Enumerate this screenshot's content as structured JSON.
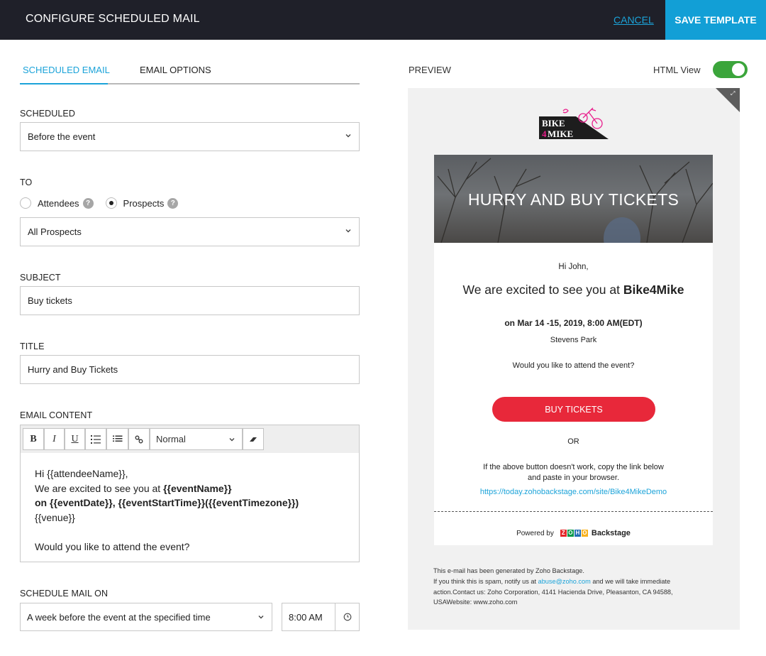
{
  "header": {
    "title": "CONFIGURE SCHEDULED MAIL",
    "cancel_label": "CANCEL",
    "save_label": "SAVE TEMPLATE"
  },
  "colors": {
    "header_bg": "#1f2029",
    "accent": "#129fd6",
    "toggle_on": "#3ba53b",
    "cta_red": "#e8283a"
  },
  "tabs": [
    {
      "label": "SCHEDULED EMAIL",
      "active": true
    },
    {
      "label": "EMAIL OPTIONS",
      "active": false
    }
  ],
  "form": {
    "scheduled": {
      "label": "SCHEDULED",
      "value": "Before the event"
    },
    "to": {
      "label": "TO",
      "options": [
        {
          "label": "Attendees",
          "selected": false,
          "help_icon": "question-mark-icon"
        },
        {
          "label": "Prospects",
          "selected": true,
          "help_icon": "question-mark-icon"
        }
      ],
      "audience_value": "All Prospects"
    },
    "subject": {
      "label": "SUBJECT",
      "value": "Buy tickets"
    },
    "title": {
      "label": "TITLE",
      "value": "Hurry and Buy Tickets"
    },
    "email_content": {
      "label": "EMAIL CONTENT",
      "toolbar": {
        "bold": "B",
        "italic": "I",
        "underline": "U",
        "ordered_list_icon": "ordered-list-icon",
        "bullet_list_icon": "bullet-list-icon",
        "link_icon": "link-icon",
        "format_value": "Normal",
        "clear_format_icon": "eraser-icon"
      },
      "body": {
        "line1": "Hi {{attendeeName}},",
        "line2_plain": "We are excited to see you at ",
        "line2_bold": "{{eventName}}",
        "line3_bold": "on {{eventDate}}, {{eventStartTime}}({{eventTimezone}})",
        "line4": "{{venue}}",
        "line6": "Would you like to attend the event?"
      }
    },
    "schedule_mail_on": {
      "label": "SCHEDULE MAIL ON",
      "value": "A week before the event at the specified time",
      "time": "8:00 AM"
    }
  },
  "preview": {
    "label": "PREVIEW",
    "html_view_label": "HTML View",
    "html_view_on": true,
    "logo": {
      "line1": "BIKE",
      "line2_num": "4",
      "line2_word": "MIKE"
    },
    "hero_title": "HURRY AND BUY TICKETS",
    "greeting": "Hi John,",
    "headline_plain": "We are excited to see you at ",
    "headline_bold": "Bike4Mike",
    "date_line": "on Mar 14 -15, 2019, 8:00 AM(EDT)",
    "venue": "Stevens Park",
    "question": "Would you like to attend the event?",
    "cta_label": "BUY TICKETS",
    "or_text": "OR",
    "fallback_line1": "If the above button doesn't work, copy the link below",
    "fallback_line2": "and paste in your browser.",
    "fallback_link": "https://today.zohobackstage.com/site/Bike4MikeDemo",
    "powered_by": "Powered by",
    "zoho_letters": [
      "Z",
      "O",
      "H",
      "O"
    ],
    "backstage_word": "Backstage",
    "footer": {
      "line1": "This e-mail has been generated by Zoho Backstage.",
      "line2_pre": "If you think this is spam, notify us at ",
      "line2_email": "abuse@zoho.com",
      "line2_post": " and we will take immediate",
      "line3": "action.Contact us: Zoho Corporation, 4141 Hacienda Drive, Pleasanton, CA 94588,",
      "line4": "USAWebsite: www.zoho.com"
    }
  }
}
